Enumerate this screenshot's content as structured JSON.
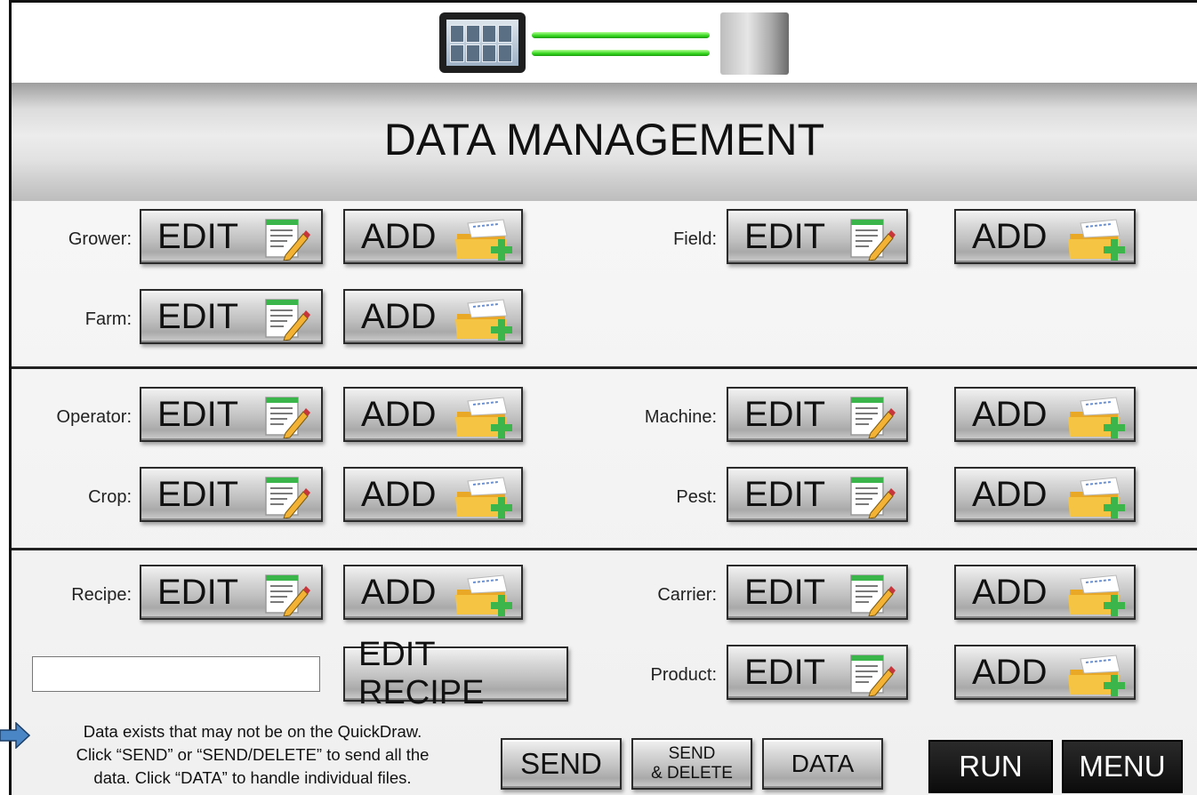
{
  "header": {
    "title": "DATA MANAGEMENT"
  },
  "colors": {
    "link_green": "#33d61e",
    "dark_button": "#111111",
    "arrow_blue": "#4a86c5"
  },
  "sections": {
    "grower": {
      "label": "Grower:",
      "edit": "EDIT",
      "add": "ADD"
    },
    "farm": {
      "label": "Farm:",
      "edit": "EDIT",
      "add": "ADD"
    },
    "field": {
      "label": "Field:",
      "edit": "EDIT",
      "add": "ADD"
    },
    "operator": {
      "label": "Operator:",
      "edit": "EDIT",
      "add": "ADD"
    },
    "machine": {
      "label": "Machine:",
      "edit": "EDIT",
      "add": "ADD"
    },
    "crop": {
      "label": "Crop:",
      "edit": "EDIT",
      "add": "ADD"
    },
    "pest": {
      "label": "Pest:",
      "edit": "EDIT",
      "add": "ADD"
    },
    "recipe": {
      "label": "Recipe:",
      "edit": "EDIT",
      "add": "ADD"
    },
    "carrier": {
      "label": "Carrier:",
      "edit": "EDIT",
      "add": "ADD"
    },
    "product": {
      "label": "Product:",
      "edit": "EDIT",
      "add": "ADD"
    }
  },
  "recipe": {
    "input_value": "",
    "edit_recipe_label": "EDIT RECIPE"
  },
  "notice": {
    "line1": "Data exists that may not be on the QuickDraw.",
    "line2": "Click “SEND” or “SEND/DELETE” to send all the",
    "line3": "data.  Click “DATA” to handle individual files."
  },
  "footer": {
    "send": "SEND",
    "send_delete_1": "SEND",
    "send_delete_2": "& DELETE",
    "data": "DATA",
    "run": "RUN",
    "menu": "MENU"
  },
  "icons": {
    "edit": "notepad-pencil-icon",
    "add": "folder-plus-icon"
  }
}
